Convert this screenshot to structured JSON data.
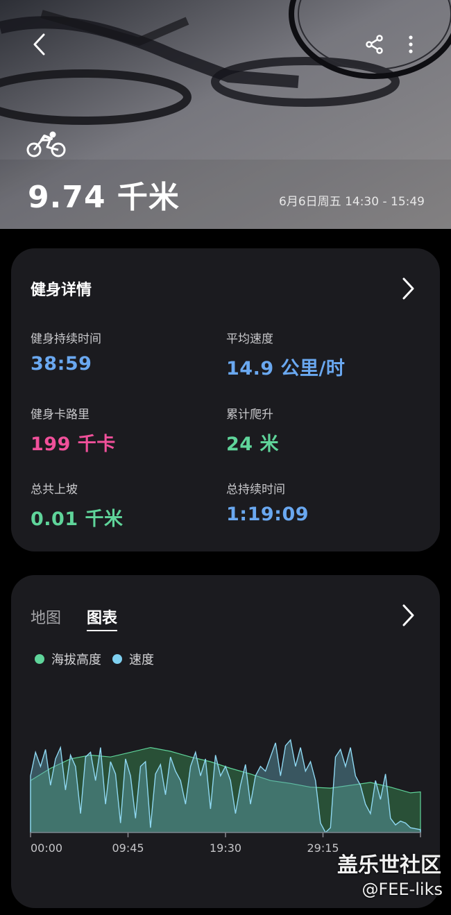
{
  "hero": {
    "distance": "9.74 千米",
    "datetime": "6月6日周五 14:30 - 15:49",
    "activity_icon": "cycling-icon"
  },
  "toolbar": {
    "back_icon": "back-arrow-icon",
    "share_icon": "share-icon",
    "more_icon": "more-vertical-icon"
  },
  "details": {
    "title": "健身详情",
    "metrics": [
      {
        "label": "健身持续时间",
        "value": "38:59",
        "color": "#6aa8f0"
      },
      {
        "label": "平均速度",
        "value": "14.9 公里/时",
        "color": "#6aa8f0"
      },
      {
        "label": "健身卡路里",
        "value": "199 千卡",
        "color": "#f0509a"
      },
      {
        "label": "累计爬升",
        "value": "24 米",
        "color": "#5fd49a"
      },
      {
        "label": "总共上坡",
        "value": "0.01 千米",
        "color": "#5fd49a"
      },
      {
        "label": "总持续时间",
        "value": "1:19:09",
        "color": "#6aa8f0"
      }
    ]
  },
  "chart_card": {
    "tabs": [
      {
        "label": "地图",
        "active": false
      },
      {
        "label": "图表",
        "active": true
      }
    ],
    "legend": [
      {
        "label": "海拔高度",
        "color": "#5fd49a"
      },
      {
        "label": "速度",
        "color": "#7fd0f0"
      }
    ]
  },
  "chart_data": {
    "type": "area",
    "x_ticks": [
      "00:00",
      "09:45",
      "19:30",
      "29:15"
    ],
    "grid": false,
    "series": [
      {
        "name": "海拔高度",
        "color": "#5fd49a",
        "x_minutes": [
          0,
          2,
          4,
          6,
          8,
          10,
          12,
          14,
          16,
          18,
          20,
          22,
          24,
          26,
          28,
          30,
          32,
          34,
          36,
          38,
          39
        ],
        "relative_level": [
          0.55,
          0.68,
          0.78,
          0.82,
          0.8,
          0.85,
          0.9,
          0.86,
          0.8,
          0.75,
          0.68,
          0.62,
          0.55,
          0.52,
          0.48,
          0.47,
          0.5,
          0.53,
          0.48,
          0.42,
          0.43
        ]
      },
      {
        "name": "速度",
        "color": "#7fd0f0",
        "x_minutes": [
          0,
          0.5,
          1,
          1.5,
          2,
          2.5,
          3,
          3.5,
          4,
          4.5,
          5,
          5.5,
          6,
          6.5,
          7,
          7.5,
          8,
          8.5,
          9,
          9.5,
          10,
          10.5,
          11,
          11.5,
          12,
          12.5,
          13,
          13.5,
          14,
          14.5,
          15,
          15.5,
          16,
          16.5,
          17,
          17.5,
          18,
          18.5,
          19,
          19.5,
          20,
          20.5,
          21,
          21.5,
          22,
          22.5,
          23,
          23.5,
          24,
          24.5,
          25,
          25.5,
          26,
          26.5,
          27,
          27.5,
          28,
          28.5,
          29,
          29.5,
          30,
          30.5,
          31,
          31.5,
          32,
          32.5,
          33,
          33.5,
          34,
          34.5,
          35,
          35.5,
          36,
          36.5,
          37,
          37.5,
          38,
          38.5,
          39
        ],
        "relative_level": [
          0.6,
          0.85,
          0.7,
          0.88,
          0.5,
          0.78,
          0.9,
          0.45,
          0.82,
          0.7,
          0.2,
          0.8,
          0.85,
          0.55,
          0.9,
          0.3,
          0.75,
          0.62,
          0.1,
          0.78,
          0.6,
          0.15,
          0.7,
          0.75,
          0.05,
          0.62,
          0.72,
          0.4,
          0.8,
          0.65,
          0.55,
          0.3,
          0.7,
          0.85,
          0.6,
          0.78,
          0.25,
          0.82,
          0.6,
          0.7,
          0.55,
          0.2,
          0.5,
          0.72,
          0.3,
          0.6,
          0.7,
          0.65,
          0.8,
          0.95,
          0.6,
          0.92,
          0.98,
          0.7,
          0.9,
          0.65,
          0.75,
          0.55,
          0.1,
          0.0,
          0.05,
          0.8,
          0.88,
          0.7,
          0.9,
          0.6,
          0.5,
          0.3,
          0.2,
          0.55,
          0.35,
          0.62,
          0.15,
          0.08,
          0.12,
          0.1,
          0.05,
          0.04,
          0.03
        ]
      }
    ]
  },
  "watermark": {
    "line1": "盖乐世社区",
    "line2": "@FEE-liks"
  }
}
